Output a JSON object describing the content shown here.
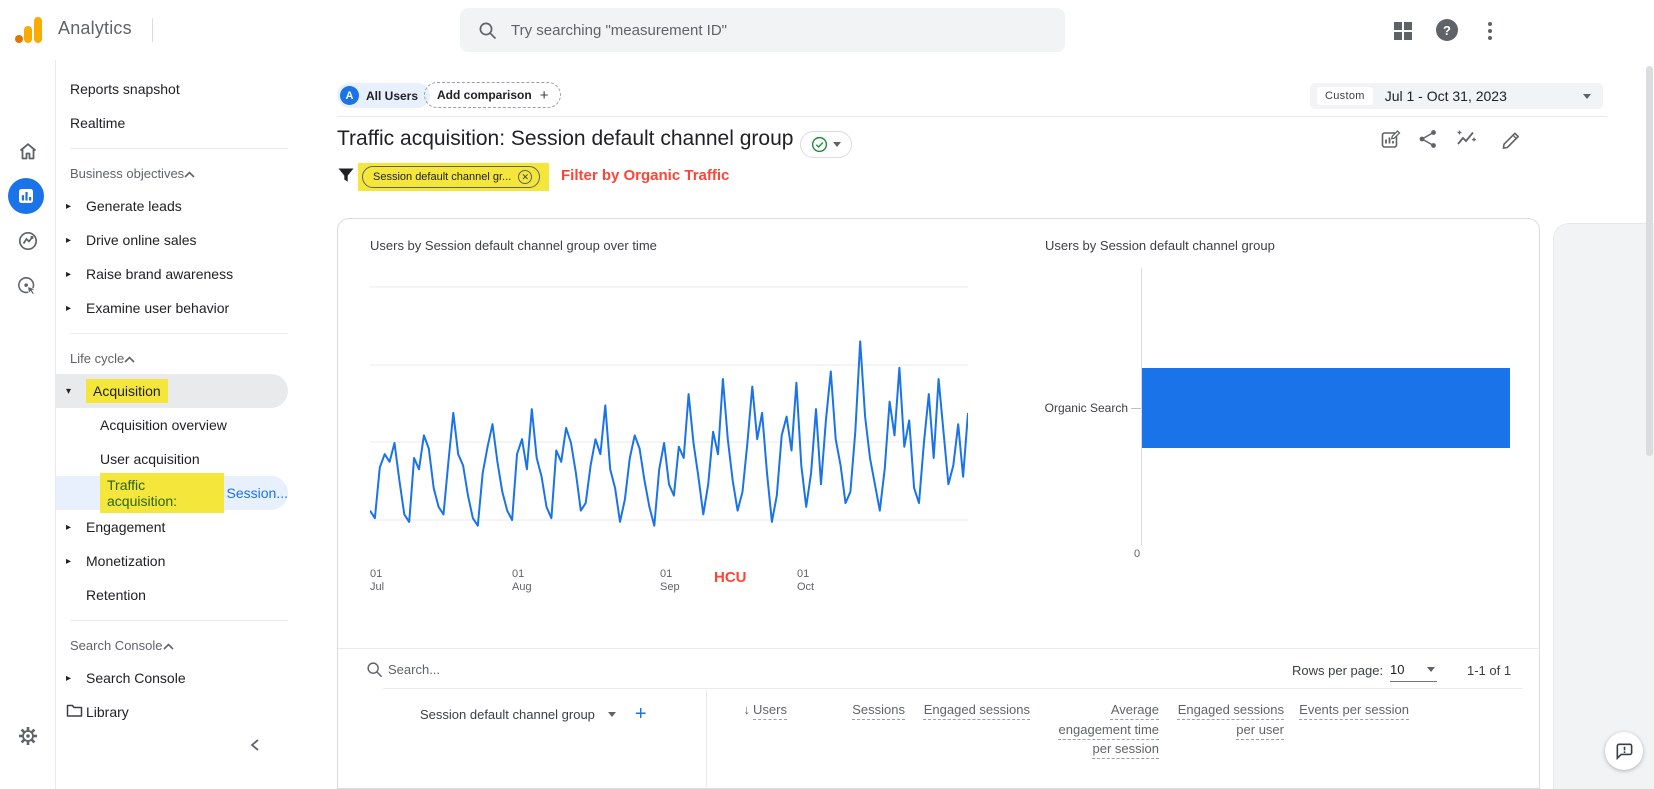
{
  "app": {
    "title": "Analytics",
    "search_placeholder": "Try searching \"measurement ID\""
  },
  "rail": {
    "items": [
      {
        "icon": "home"
      },
      {
        "icon": "reports",
        "selected": true
      },
      {
        "icon": "explore"
      },
      {
        "icon": "advertising"
      }
    ],
    "bottom_icon": "settings-gear"
  },
  "sidebar": {
    "top_items": [
      {
        "label": "Reports snapshot"
      },
      {
        "label": "Realtime"
      }
    ],
    "sections": [
      {
        "title": "Business objectives",
        "items": [
          {
            "label": "Generate leads",
            "arrow": "collapsed"
          },
          {
            "label": "Drive online sales",
            "arrow": "collapsed"
          },
          {
            "label": "Raise brand awareness",
            "arrow": "collapsed"
          },
          {
            "label": "Examine user behavior",
            "arrow": "collapsed"
          }
        ]
      },
      {
        "title": "Life cycle",
        "items": [
          {
            "label": "Acquisition",
            "arrow": "expanded",
            "row_bg": "gray",
            "highlight": true
          },
          {
            "label": "Acquisition overview",
            "indent": 2
          },
          {
            "label": "User acquisition",
            "indent": 2
          },
          {
            "label": "Traffic acquisition:",
            "suffix": "Session...",
            "indent": 2,
            "selected": true,
            "highlight": true
          },
          {
            "label": "Engagement",
            "arrow": "collapsed"
          },
          {
            "label": "Monetization",
            "arrow": "collapsed"
          },
          {
            "label": "Retention"
          }
        ]
      },
      {
        "title": "Search Console",
        "items": [
          {
            "label": "Search Console",
            "arrow": "collapsed"
          },
          {
            "label": "Library",
            "icon": "folder"
          }
        ]
      }
    ]
  },
  "header": {
    "avatar_letter": "A",
    "all_users_label": "All Users",
    "add_comparison_label": "Add comparison",
    "date_custom_label": "Custom",
    "date_range": "Jul 1 - Oct 31, 2023"
  },
  "report": {
    "title": "Traffic acquisition: Session default channel group",
    "filter_chip_label": "Session default channel gr..."
  },
  "annotations": {
    "filter_label": "Filter by Organic Traffic",
    "hcu_label": "HCU",
    "color": "#ff4336"
  },
  "chart_data": [
    {
      "type": "line",
      "title": "Users by Session default channel group over time",
      "series": [
        {
          "name": "Users",
          "values": [
            22,
            18,
            45,
            52,
            48,
            58,
            38,
            20,
            16,
            50,
            44,
            62,
            55,
            34,
            24,
            20,
            48,
            74,
            52,
            46,
            30,
            18,
            14,
            42,
            56,
            68,
            48,
            32,
            22,
            17,
            52,
            60,
            44,
            76,
            50,
            40,
            24,
            18,
            54,
            48,
            66,
            58,
            42,
            22,
            26,
            46,
            60,
            52,
            78,
            44,
            34,
            16,
            28,
            50,
            62,
            55,
            38,
            24,
            14,
            44,
            58,
            36,
            30,
            56,
            50,
            84,
            58,
            40,
            20,
            36,
            64,
            52,
            92,
            60,
            38,
            22,
            32,
            58,
            88,
            60,
            74,
            42,
            16,
            30,
            62,
            72,
            54,
            90,
            46,
            24,
            42,
            76,
            36,
            70,
            96,
            60,
            46,
            26,
            32,
            64,
            112,
            72,
            50,
            36,
            22,
            44,
            80,
            62,
            98,
            56,
            70,
            34,
            26,
            58,
            84,
            50,
            92,
            64,
            36,
            46,
            68,
            40,
            74
          ]
        }
      ],
      "x_tick_labels": [
        "01 Jul",
        "01 Aug",
        "01 Sep",
        "01 Oct"
      ],
      "x_range": "daily, Jul 1 - Oct 31, 2023",
      "y_axis_labels": [],
      "y_max_estimate": 140,
      "line_color": "#1a73e8",
      "grid": true,
      "note": "daily Users values estimated from pixels; chart shows no y-axis labels"
    },
    {
      "type": "bar",
      "orientation": "horizontal",
      "title": "Users by Session default channel group",
      "categories": [
        "Organic Search"
      ],
      "values": [
        null
      ],
      "x_axis_ticks": [
        "0"
      ],
      "bar_color": "#1a73e8",
      "note": "single bar extends beyond visible plot; numeric value not displayed"
    }
  ],
  "table": {
    "search_placeholder": "Search...",
    "rows_per_page_label": "Rows per page:",
    "rows_per_page_value": "10",
    "pagination": "1-1 of 1",
    "dimension_header": "Session default channel group",
    "sort_column": "Users",
    "columns": [
      "Users",
      "Sessions",
      "Engaged sessions",
      "Average engagement time per session",
      "Engaged sessions per user",
      "Events per session"
    ]
  },
  "colors": {
    "accent_blue": "#1a73e8",
    "highlight_yellow": "#f4e63a",
    "annotation_red": "#ff4336",
    "selected_bg": "#e8f0fe"
  }
}
